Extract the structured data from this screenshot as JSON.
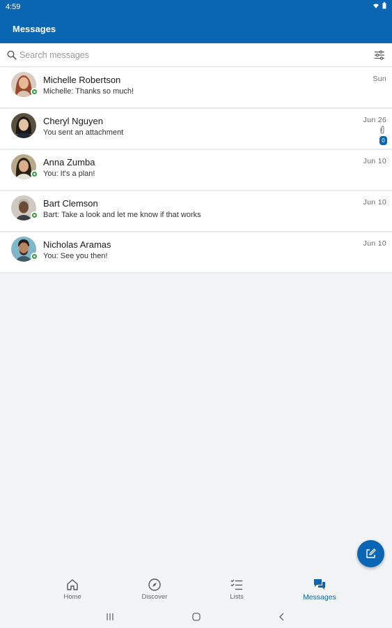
{
  "status": {
    "time": "4:59"
  },
  "app": {
    "title": "Messages"
  },
  "search": {
    "placeholder": "Search messages"
  },
  "conversations": [
    {
      "name": "Michelle Robertson",
      "snippet": "Michelle: Thanks so much!",
      "date": "Sun",
      "online": true
    },
    {
      "name": "Cheryl Nguyen",
      "snippet": "You sent an attachment",
      "date": "Jun 26",
      "online": false,
      "attachment": true,
      "badge": "0"
    },
    {
      "name": "Anna Zumba",
      "snippet": "You: It's a plan!",
      "date": "Jun 10",
      "online": true
    },
    {
      "name": "Bart Clemson",
      "snippet": "Bart: Take a look and let me know if that works",
      "date": "Jun 10",
      "online": true
    },
    {
      "name": "Nicholas Aramas",
      "snippet": "You: See you then!",
      "date": "Jun 10",
      "online": true
    }
  ],
  "nav": {
    "home": "Home",
    "discover": "Discover",
    "lists": "Lists",
    "messages": "Messages"
  },
  "colors": {
    "brand": "#0a66b2",
    "presence": "#2e9e3f"
  },
  "icons": [
    "search-icon",
    "filter-icon",
    "compose-icon",
    "home-icon",
    "compass-icon",
    "checklist-icon",
    "chat-icon",
    "paperclip-icon"
  ]
}
